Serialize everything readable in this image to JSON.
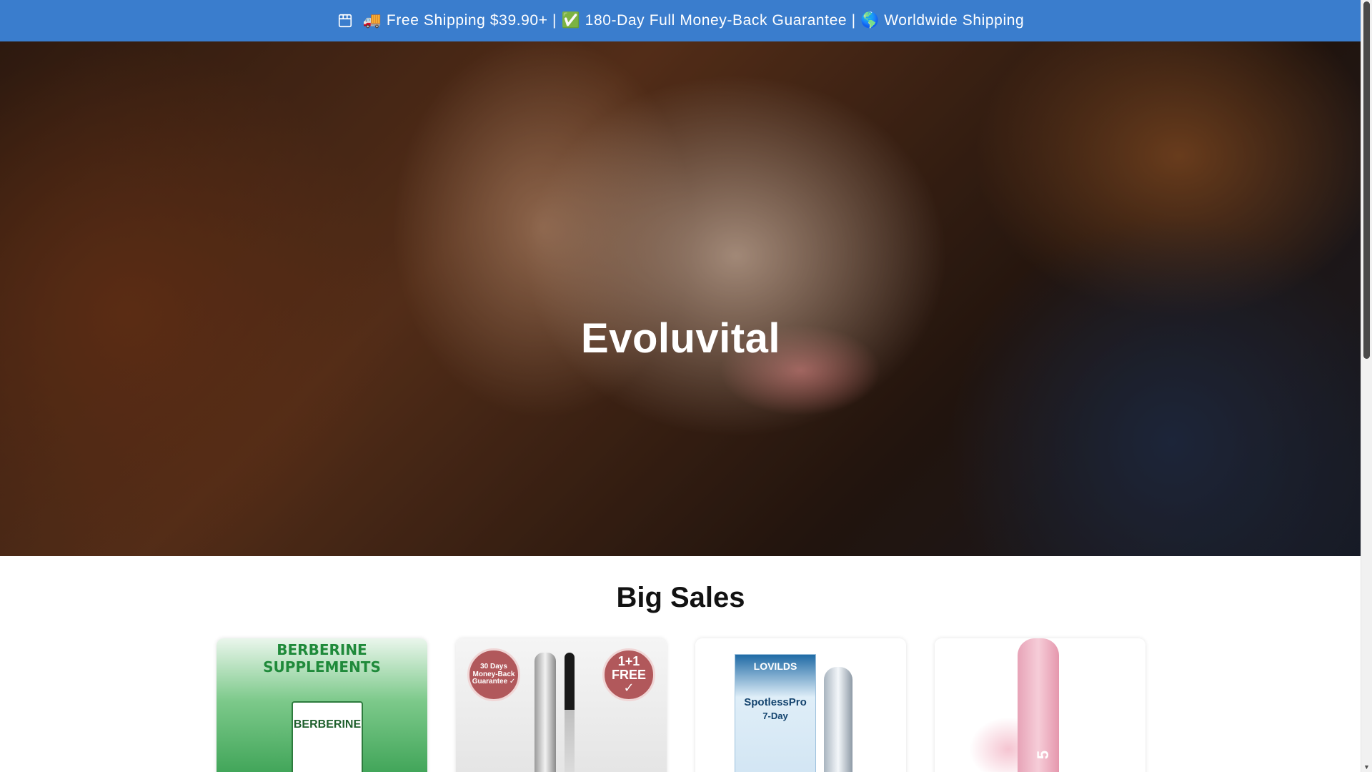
{
  "announcement": {
    "text": "🚚 Free Shipping $39.90+ | ✅ 180-Day Full Money-Back Guarantee | 🌎 Worldwide Shipping",
    "icon": "store-icon",
    "background_color": "#3a7dcd"
  },
  "hero": {
    "title": "Evoluvital"
  },
  "section": {
    "title": "Big Sales"
  },
  "products": [
    {
      "image_banner": "BERBERINE SUPPLEMENTS",
      "image_box_label": "BERBERINE"
    },
    {
      "badge_left": "30 Days Money-Back Guarantee ✓",
      "badge_right": "1+1 FREE ✓"
    },
    {
      "image_brand": "LOVILDS",
      "image_name": "SpotlessPro",
      "image_sub": "7-Day"
    },
    {
      "image_label": "5"
    }
  ],
  "scrollbar": {
    "up_arrow": "▲",
    "down_arrow": "▼"
  }
}
